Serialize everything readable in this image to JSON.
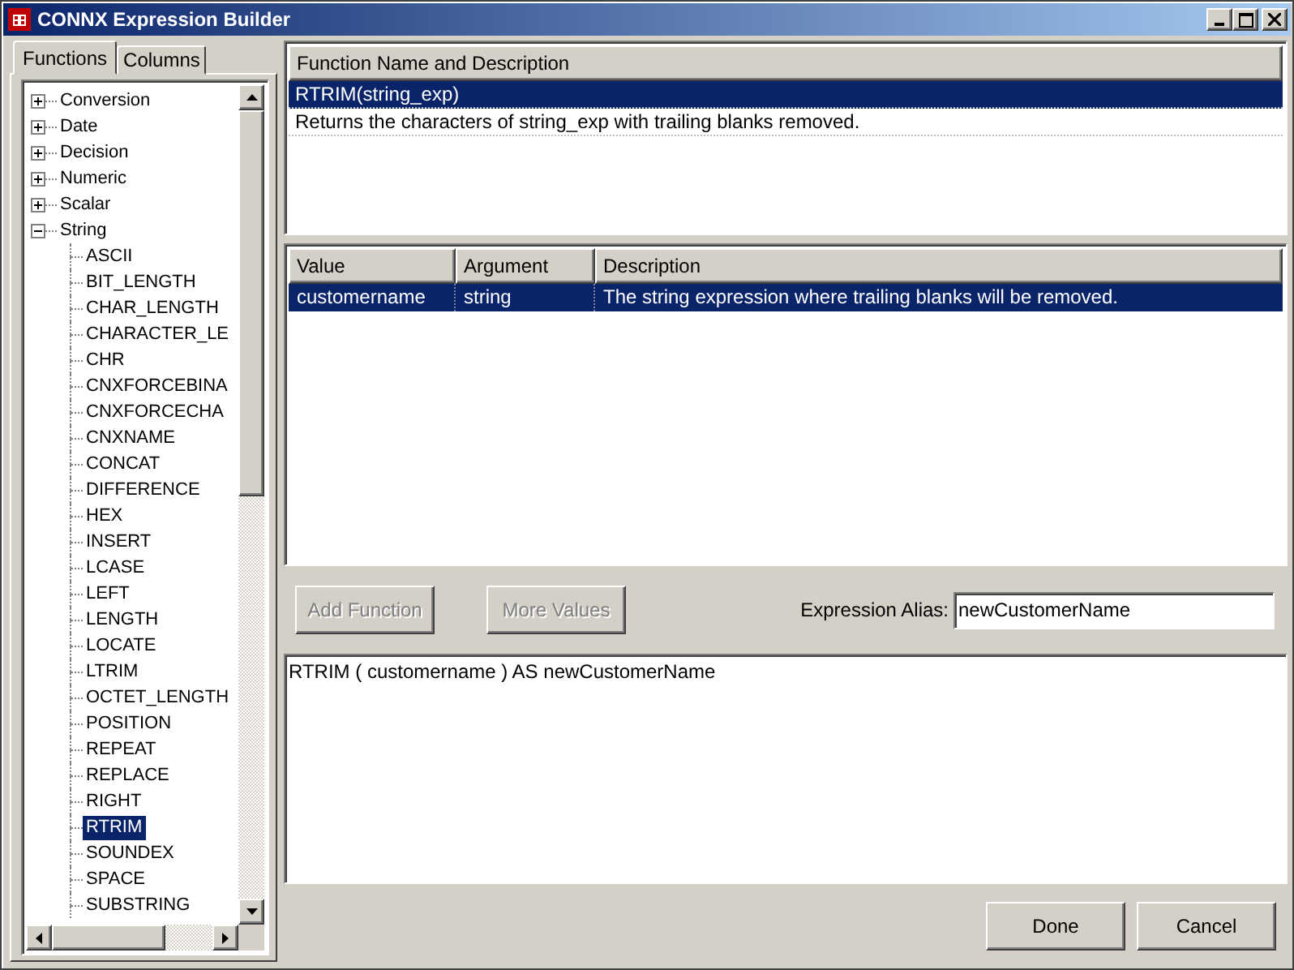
{
  "window": {
    "title": "CONNX Expression Builder"
  },
  "tabs": [
    {
      "label": "Functions",
      "selected": true
    },
    {
      "label": "Columns",
      "selected": false
    }
  ],
  "tree": [
    {
      "label": "Conversion",
      "expanded": false,
      "selected": false
    },
    {
      "label": "Date",
      "expanded": false,
      "selected": false
    },
    {
      "label": "Decision",
      "expanded": false,
      "selected": false
    },
    {
      "label": "Numeric",
      "expanded": false,
      "selected": false
    },
    {
      "label": "Scalar",
      "expanded": false,
      "selected": false
    },
    {
      "label": "String",
      "expanded": true,
      "selected": false,
      "children": [
        {
          "label": "ASCII",
          "selected": false
        },
        {
          "label": "BIT_LENGTH",
          "selected": false
        },
        {
          "label": "CHAR_LENGTH",
          "selected": false
        },
        {
          "label": "CHARACTER_LE",
          "selected": false
        },
        {
          "label": "CHR",
          "selected": false
        },
        {
          "label": "CNXFORCEBINA",
          "selected": false
        },
        {
          "label": "CNXFORCECHA",
          "selected": false
        },
        {
          "label": "CNXNAME",
          "selected": false
        },
        {
          "label": "CONCAT",
          "selected": false
        },
        {
          "label": "DIFFERENCE",
          "selected": false
        },
        {
          "label": "HEX",
          "selected": false
        },
        {
          "label": "INSERT",
          "selected": false
        },
        {
          "label": "LCASE",
          "selected": false
        },
        {
          "label": "LEFT",
          "selected": false
        },
        {
          "label": "LENGTH",
          "selected": false
        },
        {
          "label": "LOCATE",
          "selected": false
        },
        {
          "label": "LTRIM",
          "selected": false
        },
        {
          "label": "OCTET_LENGTH",
          "selected": false
        },
        {
          "label": "POSITION",
          "selected": false
        },
        {
          "label": "REPEAT",
          "selected": false
        },
        {
          "label": "REPLACE",
          "selected": false
        },
        {
          "label": "RIGHT",
          "selected": false
        },
        {
          "label": "RTRIM",
          "selected": true
        },
        {
          "label": "SOUNDEX",
          "selected": false
        },
        {
          "label": "SPACE",
          "selected": false
        },
        {
          "label": "SUBSTRING",
          "selected": false
        }
      ]
    }
  ],
  "functions": {
    "column": "Function Name and Description",
    "rows": [
      {
        "text": "RTRIM(string_exp)",
        "selected": true
      },
      {
        "text": "Returns the characters of string_exp with trailing blanks removed.",
        "selected": false
      }
    ]
  },
  "arguments": {
    "columns": [
      "Value",
      "Argument",
      "Description"
    ],
    "rows": [
      {
        "cells": [
          "customername",
          "string",
          "The string expression where trailing blanks will be removed."
        ],
        "selected": true
      }
    ]
  },
  "buttons": [
    {
      "label": "Add Function",
      "disabled": true
    },
    {
      "label": "More Values",
      "disabled": true
    }
  ],
  "alias": {
    "label": "Expression Alias:",
    "value": "newCustomerName"
  },
  "expression": "RTRIM ( customername ) AS newCustomerName",
  "dialog_buttons": [
    {
      "label": "Done",
      "disabled": false
    },
    {
      "label": "Cancel",
      "disabled": false
    }
  ]
}
